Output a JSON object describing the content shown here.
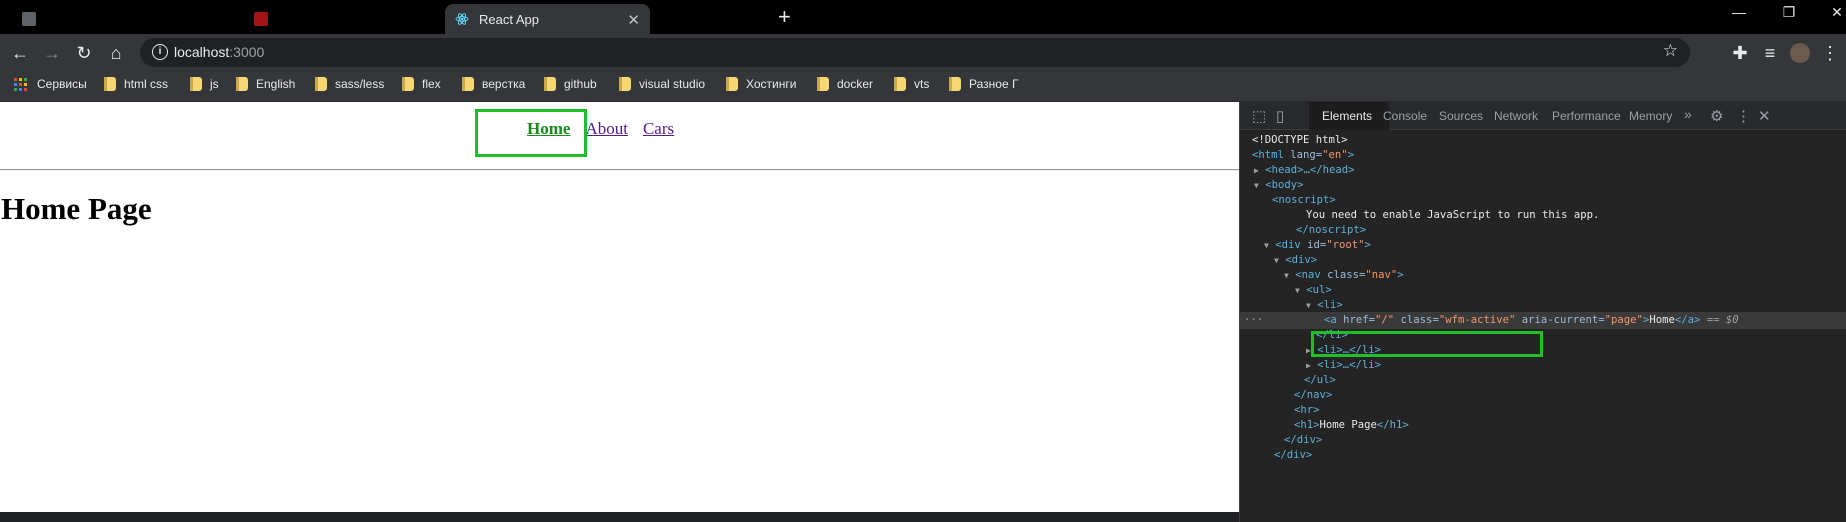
{
  "browser": {
    "tabs": [
      {
        "title": "",
        "active": false
      },
      {
        "title": "",
        "active": false
      },
      {
        "title": "React App",
        "active": true
      }
    ],
    "toolbar": {
      "url_host": "localhost",
      "url_port": ":3000"
    },
    "bookmarks": [
      {
        "label": "Сервисы",
        "kind": "apps"
      },
      {
        "label": "html css",
        "kind": "folder"
      },
      {
        "label": "js",
        "kind": "folder"
      },
      {
        "label": "English",
        "kind": "folder"
      },
      {
        "label": "sass/less",
        "kind": "folder"
      },
      {
        "label": "flex",
        "kind": "folder"
      },
      {
        "label": "верстка",
        "kind": "folder"
      },
      {
        "label": "github",
        "kind": "folder"
      },
      {
        "label": "visual studio",
        "kind": "folder"
      },
      {
        "label": "Хостинги",
        "kind": "folder"
      },
      {
        "label": "docker",
        "kind": "folder"
      },
      {
        "label": "vts",
        "kind": "folder"
      },
      {
        "label": "Разное Г",
        "kind": "folder"
      }
    ]
  },
  "page": {
    "nav": [
      "Home",
      "About",
      "Cars"
    ],
    "active_link": "Home",
    "heading": "Home Page"
  },
  "devtools": {
    "tabs": [
      "Elements",
      "Console",
      "Sources",
      "Network",
      "Performance",
      "Memory"
    ],
    "active_tab": "Elements",
    "more": "»",
    "dom": {
      "doctype": "<!DOCTYPE html>",
      "html_tag": "<html ",
      "html_attr": "lang=",
      "html_val": "\"en\"",
      "head": "<head>…</head>",
      "body": "<body>",
      "noscript_open": "<noscript>",
      "noscript_text": "You need to enable JavaScript to run this app.",
      "noscript_close": "</noscript>",
      "div_root_tag": "<div ",
      "div_root_attr": "id=",
      "div_root_val": "\"root\"",
      "div_open": "<div>",
      "nav_tag": "<nav ",
      "nav_attr": "class=",
      "nav_val": "\"nav\"",
      "ul_open": "<ul>",
      "li_open": "<li>",
      "a_tag": "<a ",
      "a_href_attr": "href=",
      "a_href_val": "\"/\"",
      "a_class_attr": " class=",
      "a_class_val": "\"wfm-active\"",
      "a_aria_attr": " aria-current=",
      "a_aria_val": "\"page\"",
      "a_text": "Home",
      "a_close": "</a>",
      "eq_ref": " == ",
      "dollar0": "$0",
      "li_close": "</li>",
      "li_collapsed": "<li>…</li>",
      "ul_close": "</ul>",
      "nav_close": "</nav>",
      "hr": "<hr>",
      "h1_open": "<h1>",
      "h1_text": "Home Page",
      "h1_close": "</h1>",
      "div_close": "</div>",
      "ellipsis": "···"
    }
  },
  "colors": {
    "highlight_box": "#1fbf2a",
    "active_link": "#1a8a1a",
    "visited_link": "#551a8b"
  }
}
